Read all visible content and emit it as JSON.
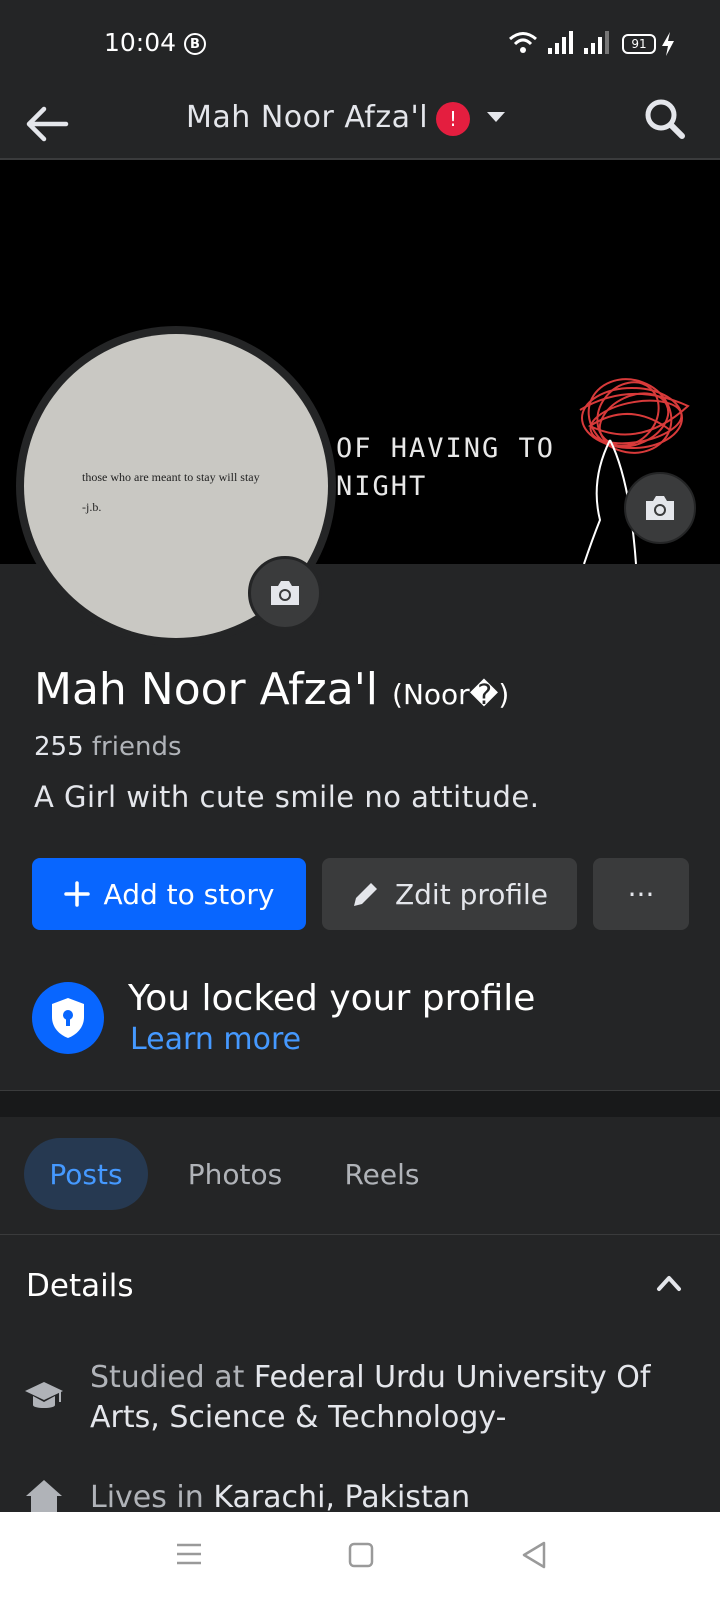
{
  "status_bar": {
    "time": "10:04",
    "b_badge": "B",
    "battery": "91"
  },
  "header": {
    "title": "Mah Noor Afza'l",
    "notification_count": "!"
  },
  "cover": {
    "text_line1": "OF HAVING TO",
    "text_line2": "NIGHT"
  },
  "avatar": {
    "quote": "those who are meant to stay will stay",
    "credit": "-j.b."
  },
  "profile": {
    "name": "Mah Noor Afza'l",
    "nickname": "(Noor�)",
    "friends_count": "255",
    "friends_label": " friends",
    "bio": "A Girl with cute smile no attitude."
  },
  "actions": {
    "add_story": "Add to story",
    "edit_profile": "Zdit profile",
    "more": "···"
  },
  "locked": {
    "title": "You locked your profile",
    "link": "Learn more"
  },
  "tabs": [
    {
      "label": "Posts"
    },
    {
      "label": "Photos"
    },
    {
      "label": "Reels"
    }
  ],
  "details": {
    "heading": "Details",
    "education_prefix": "Studied at ",
    "education_value": "Federal Urdu University Of Arts, Science & Technology-",
    "lives_prefix": "Lives in ",
    "lives_value": "Karachi, Pakistan"
  },
  "colors": {
    "background": "#242526",
    "accent": "#0866ff",
    "link": "#4599ff",
    "badge": "#e41e3f"
  },
  "icons": [
    "back-arrow-icon",
    "search-icon",
    "camera-icon",
    "plus-icon",
    "pencil-icon",
    "shield-lock-icon",
    "graduation-cap-icon",
    "home-icon",
    "chevron-up-icon"
  ]
}
